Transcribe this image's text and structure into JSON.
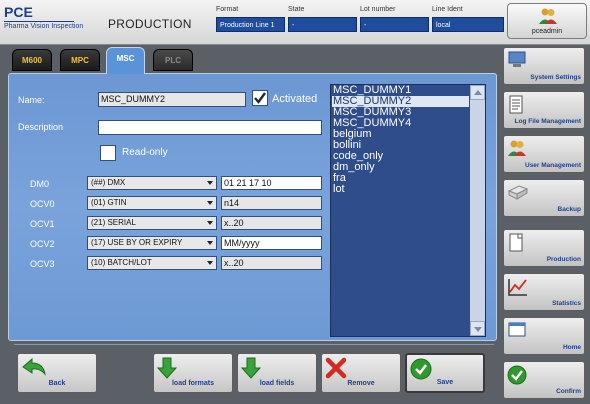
{
  "header": {
    "logo_title": "PCE",
    "logo_subtitle": "Pharma Vision Inspection",
    "module": "PRODUCTION",
    "format": {
      "label": "Format",
      "value": "Production Line 1"
    },
    "state": {
      "label": "State",
      "value": "-"
    },
    "lot_number": {
      "label": "Lot number",
      "value": "-"
    },
    "line_ident": {
      "label": "Line Ident",
      "value": "local"
    },
    "user": "pceadmin"
  },
  "tabs": [
    {
      "label": "M600"
    },
    {
      "label": "MPC"
    },
    {
      "label": "MSC"
    },
    {
      "label": "PLC"
    }
  ],
  "form": {
    "name_label": "Name:",
    "name_value": "MSC_DUMMY2",
    "activated_label": "Activated",
    "activated": true,
    "description_label": "Description",
    "description_value": "",
    "readonly_label": "Read-only",
    "readonly": false,
    "rows": [
      {
        "label": "DM0",
        "type": "(##) DMX",
        "value": "01 21 17 10"
      },
      {
        "label": "OCV0",
        "type": "(01) GTIN",
        "value": "n14"
      },
      {
        "label": "OCV1",
        "type": "(21) SERIAL",
        "value": "x..20"
      },
      {
        "label": "OCV2",
        "type": "(17) USE BY OR EXPIRY",
        "value": "MM/yyyy"
      },
      {
        "label": "OCV3",
        "type": "(10) BATCH/LOT",
        "value": "x..20"
      }
    ]
  },
  "format_list": {
    "items": [
      "MSC_DUMMY1",
      "MSC_DUMMY2",
      "MSC_DUMMY3",
      "MSC_DUMMY4",
      "belgium",
      "bollini",
      "code_only",
      "dm_only",
      "fra",
      "lot"
    ],
    "selected": "MSC_DUMMY2"
  },
  "actions": {
    "back": "Back",
    "load_formats": "load formats",
    "load_fields": "load fields",
    "remove": "Remove",
    "save": "Save"
  },
  "sidebar": [
    {
      "label": "System Settings",
      "icon": "computer-icon"
    },
    {
      "label": "Log File Management",
      "icon": "logfile-icon"
    },
    {
      "label": "User Management",
      "icon": "users-icon"
    },
    {
      "label": "Backup",
      "icon": "backup-icon"
    },
    {
      "label": "Production",
      "icon": "production-icon"
    },
    {
      "label": "Statistics",
      "icon": "statistics-icon"
    },
    {
      "label": "Home",
      "icon": "home-icon"
    },
    {
      "label": "Confirm",
      "icon": "check-icon"
    }
  ],
  "colors": {
    "panel": "#7aa3db",
    "field_header": "#1f4c9c",
    "list_bg": "#2e4d8a",
    "tab_active": "#5b93d8",
    "tab_text_inactive": "#f0c040"
  }
}
